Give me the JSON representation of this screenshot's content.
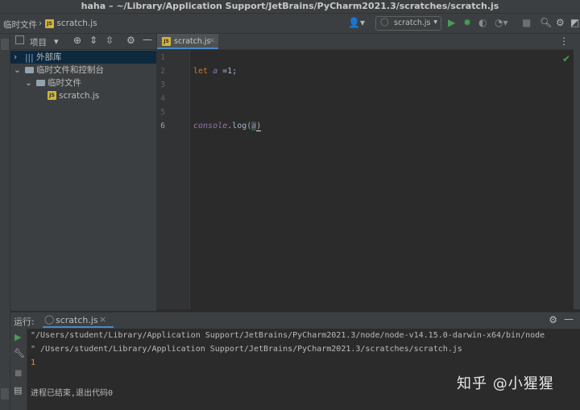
{
  "window": {
    "title": "haha – ~/Library/Application Support/JetBrains/PyCharm2021.3/scratches/scratch.js"
  },
  "navbar": {
    "breadcrumb": [
      "临时文件",
      "scratch.js"
    ],
    "run_config": "scratch.js"
  },
  "project_panel": {
    "title": "项目",
    "tree": [
      {
        "label": "外部库",
        "selected": true
      },
      {
        "label": "临时文件和控制台"
      },
      {
        "label": "临时文件"
      },
      {
        "label": "scratch.js"
      }
    ]
  },
  "editor": {
    "tab": "scratch.js",
    "line_numbers": [
      "1",
      "2",
      "3",
      "4",
      "5",
      "6"
    ],
    "code": {
      "line2": {
        "kw": "let",
        "var": "a",
        "rest": " =1;"
      },
      "line6": {
        "obj": "console",
        "dot": ".log(",
        "arg": "a",
        "close": ")"
      }
    }
  },
  "run": {
    "label": "运行:",
    "tab": "scratch.js",
    "output": [
      "\"/Users/student/Library/Application Support/JetBrains/PyCharm2021.3/node/node-v14.15.0-darwin-x64/bin/node",
      "\" /Users/student/Library/Application Support/JetBrains/PyCharm2021.3/scratches/scratch.js",
      "1",
      "",
      "进程已结束,退出代码0"
    ]
  },
  "watermark": "知乎 @小猩猩",
  "colors": {
    "accent": "#4a88c7",
    "run_green": "#499c54",
    "selection": "#0d293e"
  }
}
